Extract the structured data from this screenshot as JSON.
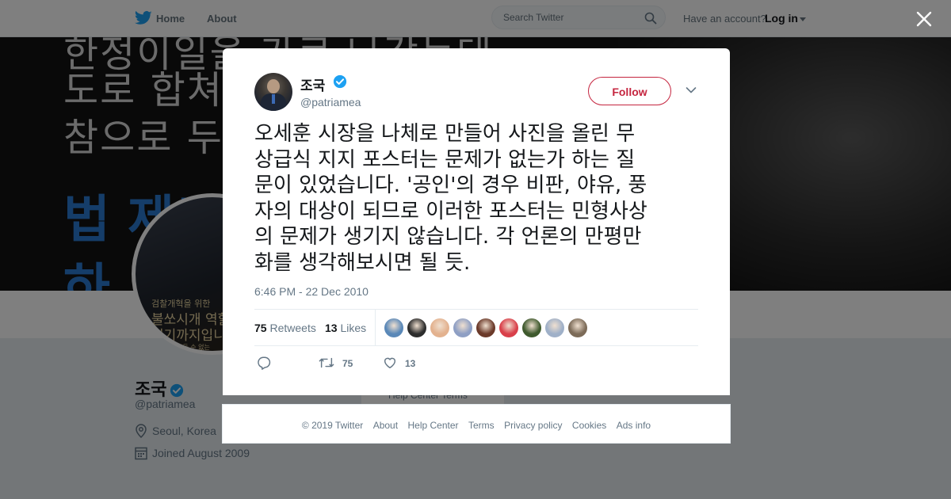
{
  "topbar": {
    "home_label": "Home",
    "about_label": "About",
    "search_placeholder": "Search Twitter",
    "account_prompt": "Have an account?",
    "login_label": "Log in"
  },
  "banner": {
    "lines": [
      "한정이일을 가로 나갔는데",
      "도로 합쳐지",
      "참으로 두려"
    ],
    "blue_lines": [
      "법 제도",
      "하"
    ]
  },
  "profile": {
    "avatar_text": [
      "검찰개혁을 위한",
      "불쏘시개 역할은",
      "여기까지입니다",
      "위험한 가족들 수 없는"
    ],
    "name": "조국",
    "handle": "@patriamea",
    "location": "Seoul, Korea",
    "joined": "Joined August 2009",
    "help_links": "Help Center   Terms"
  },
  "tweet": {
    "author_name": "조국",
    "author_handle": "@patriamea",
    "follow_label": "Follow",
    "text": "오세훈 시장을 나체로 만들어 사진을 올린 무\n상급식 지지 포스터는 문제가 없는가 하는 질\n문이 있었습니다. '공인'의 경우 비판, 야유, 풍\n자의 대상이 되므로 이러한 포스터는 민형사상\n의 문제가 생기지 않습니다. 각 언론의 만평만\n화를 생각해보시면 될 듯.",
    "timestamp": "6:46 PM - 22 Dec 2010",
    "retweets_count": "75",
    "retweets_label": "Retweets",
    "likes_count": "13",
    "likes_label": "Likes",
    "likers": [
      {
        "name": "liker-1",
        "color": "#5a88b8"
      },
      {
        "name": "liker-2",
        "color": "#2d2d2d"
      },
      {
        "name": "liker-3",
        "color": "#e3b28f"
      },
      {
        "name": "liker-4",
        "color": "#8e9fc4"
      },
      {
        "name": "liker-5",
        "color": "#6b3a2a"
      },
      {
        "name": "liker-6",
        "color": "#d9404a"
      },
      {
        "name": "liker-7",
        "color": "#3f5a2e"
      },
      {
        "name": "liker-8",
        "color": "#9fb0c8"
      },
      {
        "name": "liker-9",
        "color": "#7c6b58"
      }
    ],
    "actions": {
      "retweet_count": "75",
      "like_count": "13"
    }
  },
  "footer": {
    "copyright": "© 2019 Twitter",
    "links": [
      "About",
      "Help Center",
      "Terms",
      "Privacy policy",
      "Cookies",
      "Ads info"
    ]
  },
  "colors": {
    "twitter_blue": "#1da1f2",
    "follow_accent": "#c5253f",
    "secondary_text": "#657786"
  }
}
